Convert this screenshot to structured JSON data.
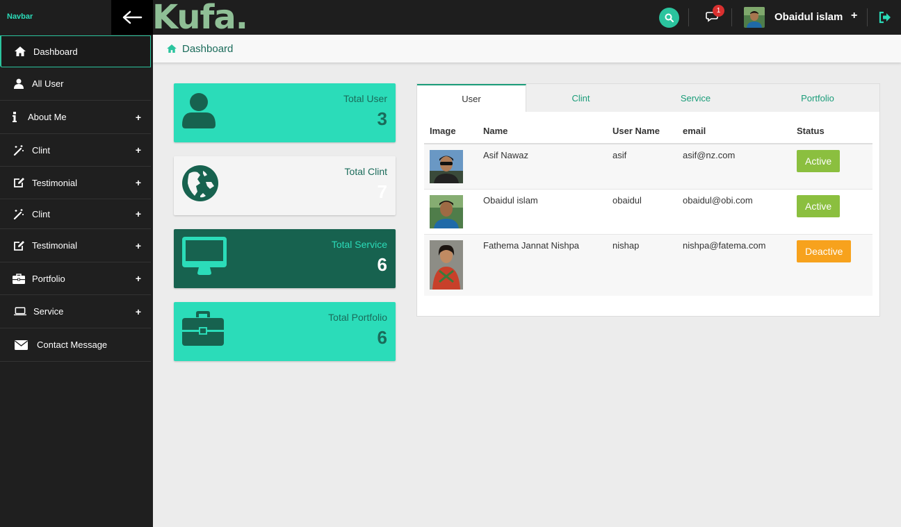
{
  "topbar": {
    "navbar_label": "Navbar",
    "logo": "Kufa.",
    "notification_count": "1",
    "user_name": "Obaidul islam",
    "user_plus": "+"
  },
  "sidebar": {
    "items": [
      {
        "label": "Dashboard",
        "icon": "home-icon",
        "has_plus": false
      },
      {
        "label": "All User",
        "icon": "user-icon",
        "has_plus": false
      },
      {
        "label": "About Me",
        "icon": "info-icon",
        "has_plus": true
      },
      {
        "label": "Clint",
        "icon": "magic-wand-icon",
        "has_plus": true
      },
      {
        "label": "Testimonial",
        "icon": "edit-icon",
        "has_plus": true
      },
      {
        "label": "Clint",
        "icon": "magic-wand-icon",
        "has_plus": true
      },
      {
        "label": "Testimonial",
        "icon": "edit-icon",
        "has_plus": true
      },
      {
        "label": "Portfolio",
        "icon": "briefcase-icon",
        "has_plus": true
      },
      {
        "label": "Service",
        "icon": "laptop-icon",
        "has_plus": true
      },
      {
        "label": "Contact Message",
        "icon": "envelope-icon",
        "has_plus": false
      }
    ],
    "plus": "+"
  },
  "breadcrumb": {
    "label": "Dashboard"
  },
  "cards": [
    {
      "label": "Total User",
      "value": "3",
      "bg": "#2bdcb9",
      "label_color": "#1a6b5a",
      "value_color": "#1a6b5a",
      "icon": "user-icon"
    },
    {
      "label": "Total Clint",
      "value": "7",
      "bg": "#f4f4f4",
      "label_color": "#1a6b5a",
      "value_color": "#ffffff",
      "icon": "globe-icon"
    },
    {
      "label": "Total Service",
      "value": "6",
      "bg": "#17624f",
      "label_color": "#2bdcb9",
      "value_color": "#ffffff",
      "icon": "monitor-icon"
    },
    {
      "label": "Total Portfolio",
      "value": "6",
      "bg": "#2bdcb9",
      "label_color": "#1a6b5a",
      "value_color": "#1a6b5a",
      "icon": "briefcase-icon"
    }
  ],
  "tabs": [
    "User",
    "Clint",
    "Service",
    "Portfolio"
  ],
  "table": {
    "headers": [
      "Image",
      "Name",
      "User Name",
      "email",
      "Status"
    ],
    "rows": [
      {
        "name": "Asif Nawaz",
        "username": "asif",
        "email": "asif@nz.com",
        "status": "Active"
      },
      {
        "name": "Obaidul islam",
        "username": "obaidul",
        "email": "obaidul@obi.com",
        "status": "Active"
      },
      {
        "name": "Fathema Jannat Nishpa",
        "username": "nishap",
        "email": "nishpa@fatema.com",
        "status": "Deactive"
      }
    ]
  },
  "colors": {
    "accent": "#2bdcb9",
    "dark_green": "#17624f",
    "active_status": "#8bbf3f",
    "deactive_status": "#f7a21d"
  }
}
